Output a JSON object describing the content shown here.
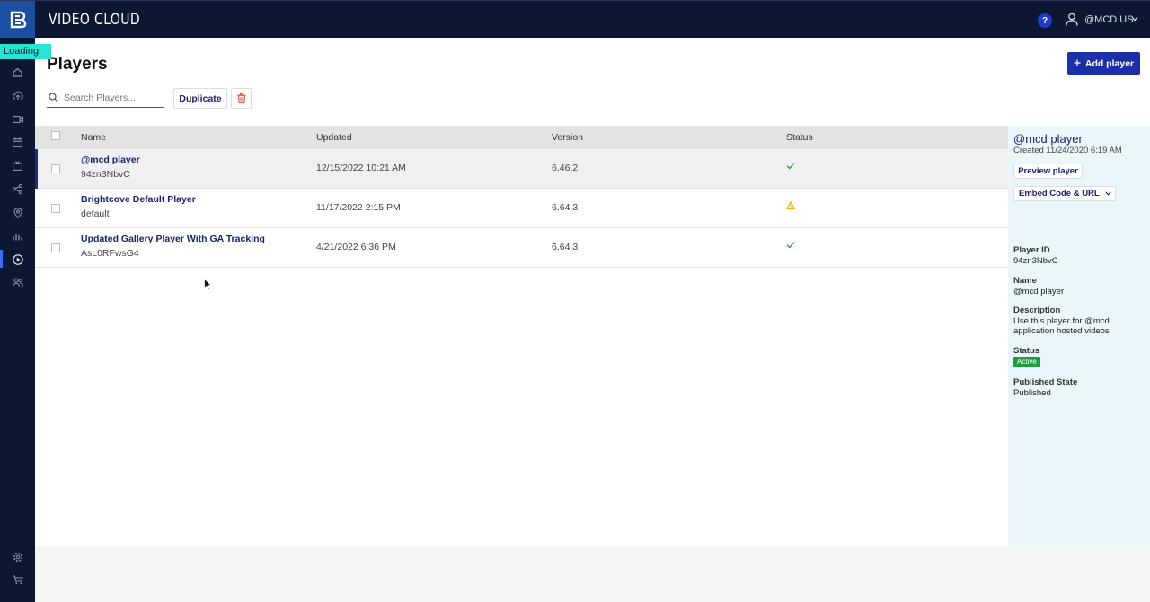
{
  "app": {
    "brand": "VIDEO CLOUD",
    "account": "@MCD US",
    "help_label": "?",
    "loading_text": "Loading ..."
  },
  "icons": {
    "nav": [
      "home-icon",
      "upload-icon",
      "media-icon",
      "schedule-icon",
      "live-icon",
      "social-icon",
      "audience-icon",
      "analytics-icon",
      "players-icon",
      "users-icon",
      "settings-icon",
      "cart-icon"
    ],
    "search": "search-icon",
    "delete": "trash-icon",
    "status_ok": "check-icon",
    "status_warn": "warning-icon"
  },
  "colors": {
    "topbar": "#0c1832",
    "accent": "#1a2fa8",
    "link": "#1a2270",
    "loading": "#27e5d4",
    "active_badge": "#1f9e3c",
    "status_ok": "#1f9e3c",
    "status_warn": "#f0a800"
  },
  "page": {
    "title": "Players",
    "add_button": "Add player",
    "search_placeholder": "Search Players...",
    "duplicate_button": "Duplicate"
  },
  "table": {
    "headers": {
      "name": "Name",
      "updated": "Updated",
      "version": "Version",
      "status": "Status"
    },
    "rows": [
      {
        "name": "@mcd player",
        "id": "94zn3NbvC",
        "updated": "12/15/2022 10:21 AM",
        "version": "6.46.2",
        "status": "ok",
        "selected": true
      },
      {
        "name": "Brightcove Default Player",
        "id": "default",
        "updated": "11/17/2022 2:15 PM",
        "version": "6.64.3",
        "status": "warning",
        "selected": false
      },
      {
        "name": "Updated Gallery Player With GA Tracking",
        "id": "AsL0RFwsG4",
        "updated": "4/21/2022 6:36 PM",
        "version": "6.64.3",
        "status": "ok",
        "selected": false
      }
    ]
  },
  "panel": {
    "title": "@mcd player",
    "created": "Created 11/24/2020 6:19 AM",
    "preview_button": "Preview player",
    "embed_button": "Embed Code & URL",
    "player_id_label": "Player ID",
    "player_id": "94zn3NbvC",
    "name_label": "Name",
    "name": "@mcd player",
    "description_label": "Description",
    "description": "Use this player for @mcd application hosted videos",
    "status_label": "Status",
    "status": "Active",
    "published_label": "Published State",
    "published": "Published"
  }
}
